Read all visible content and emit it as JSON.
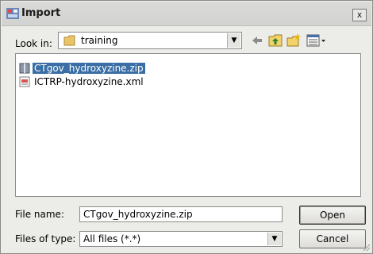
{
  "window": {
    "title": "Import",
    "close_label": "x"
  },
  "look_in": {
    "label": "Look in:",
    "value": "training"
  },
  "toolbar": {
    "icons": [
      "back-arrow-icon",
      "up-folder-icon",
      "new-folder-icon",
      "view-menu-icon"
    ]
  },
  "files": [
    {
      "name": "CTgov_hydroxyzine.zip",
      "icon": "zip-archive-icon",
      "selected": true
    },
    {
      "name": "ICTRP-hydroxyzine.xml",
      "icon": "xml-file-icon",
      "selected": false
    }
  ],
  "file_name": {
    "label": "File name:",
    "value": "CTgov_hydroxyzine.zip"
  },
  "file_type": {
    "label": "Files of type:",
    "value": "All files (*.*)"
  },
  "buttons": {
    "open": "Open",
    "cancel": "Cancel"
  }
}
